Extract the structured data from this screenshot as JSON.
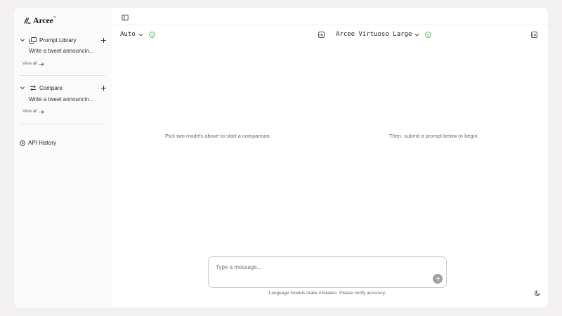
{
  "brand": {
    "name": "Arcee",
    "trademark": "™"
  },
  "sidebar": {
    "sections": [
      {
        "label": "Prompt Library",
        "items": [
          "Write a tweet announcin..."
        ],
        "view_all": "View all"
      },
      {
        "label": "Compare",
        "items": [
          "Write a tweet announcin..."
        ],
        "view_all": "View all"
      }
    ],
    "api_history": "API History"
  },
  "panels": [
    {
      "model": "Auto",
      "hint": "Pick two models above to start a comparison."
    },
    {
      "model": "Arcee Virtuoso Large",
      "hint": "Then, submit a prompt below to begin."
    }
  ],
  "composer": {
    "placeholder": "Type a message...",
    "disclaimer": "Language models make mistakes. Please verify accuracy."
  },
  "colors": {
    "price_badge": "#3bb35a",
    "send_button": "#a3a0a1",
    "background": "#f3f0f1"
  },
  "icons": {
    "sidebar_toggle": "panel-left-icon",
    "library": "library-icon",
    "compare": "compare-arrows-icon",
    "history": "clock-icon",
    "price": "dollar-circle-icon",
    "model_info": "card-icon",
    "send": "arrow-up-icon",
    "theme": "moon-icon"
  }
}
